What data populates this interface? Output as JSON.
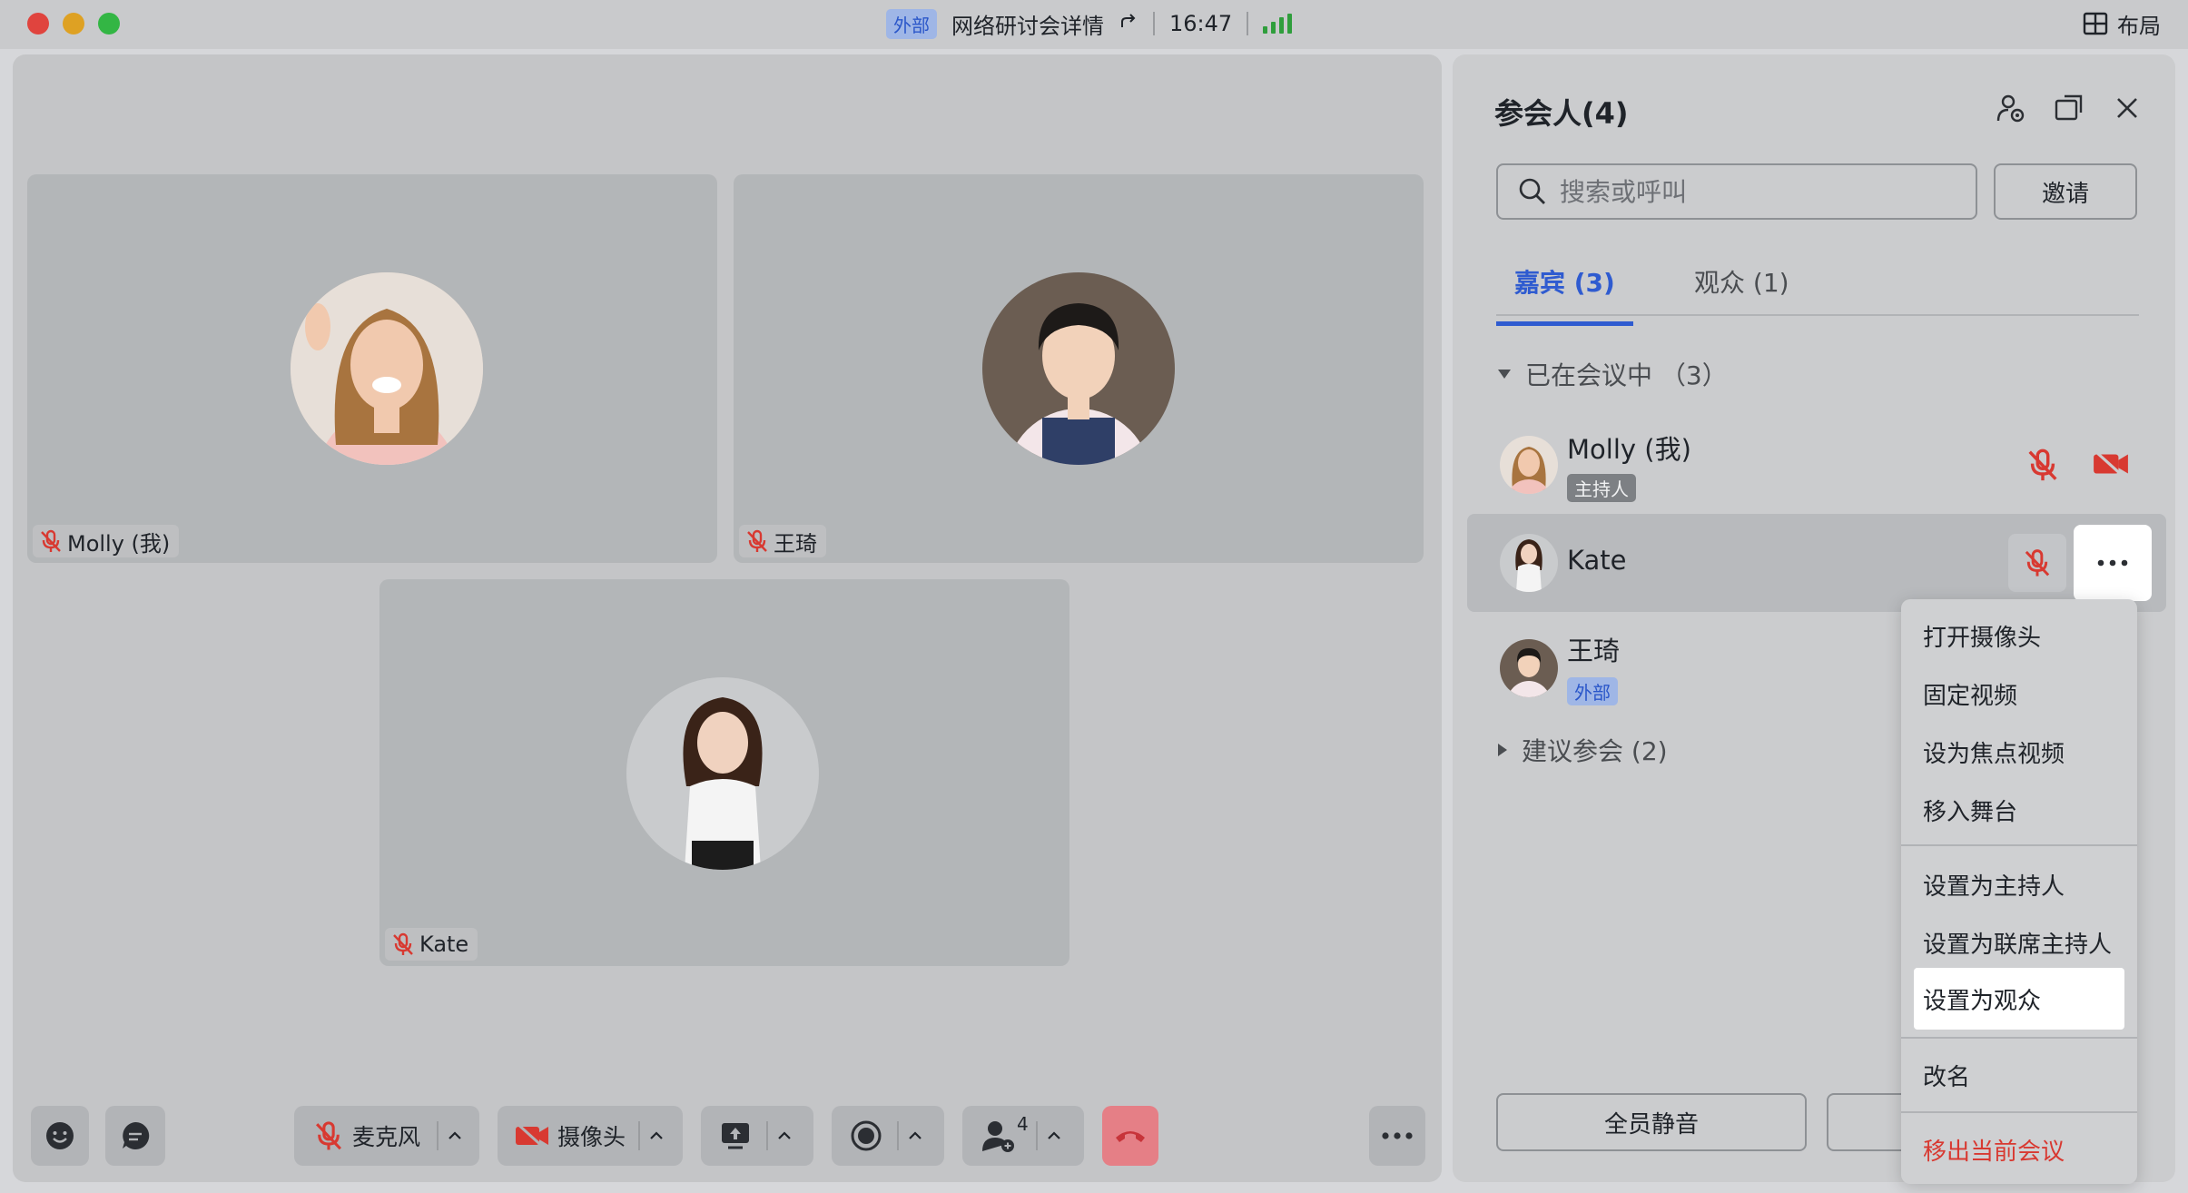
{
  "titlebar": {
    "external_badge": "外部",
    "meeting_title": "网络研讨会详情",
    "time": "16:47",
    "layout_label": "布局"
  },
  "stage": {
    "tiles": [
      {
        "name": "Molly (我)",
        "muted": true
      },
      {
        "name": "王琦",
        "muted": true
      },
      {
        "name": "Kate",
        "muted": true
      }
    ]
  },
  "toolbar": {
    "mic_label": "麦克风",
    "camera_label": "摄像头",
    "participants_count": "4"
  },
  "panel": {
    "title": "参会人(4)",
    "search_placeholder": "搜索或呼叫",
    "invite_label": "邀请",
    "tab_guests": "嘉宾 (3)",
    "tab_audience": "观众 (1)",
    "section_in_meeting": "已在会议中 （3）",
    "section_suggested": "建议参会 (2)",
    "participants": [
      {
        "name": "Molly (我)",
        "role": "主持人"
      },
      {
        "name": "Kate",
        "role": ""
      },
      {
        "name": "王琦",
        "role": "外部"
      }
    ],
    "mute_all_label": "全员静音"
  },
  "context_menu": {
    "items": [
      "打开摄像头",
      "固定视频",
      "设为焦点视频",
      "移入舞台",
      "设置为主持人",
      "设置为联席主持人",
      "设置为观众",
      "改名",
      "移出当前会议"
    ],
    "hovered": "设置为观众",
    "danger_item": "移出当前会议"
  },
  "colors": {
    "accent": "#2f5bd0",
    "danger": "#d83931",
    "muted_icon": "#d83931",
    "signal": "#2f9e3c",
    "end_call": "#e57f86"
  }
}
